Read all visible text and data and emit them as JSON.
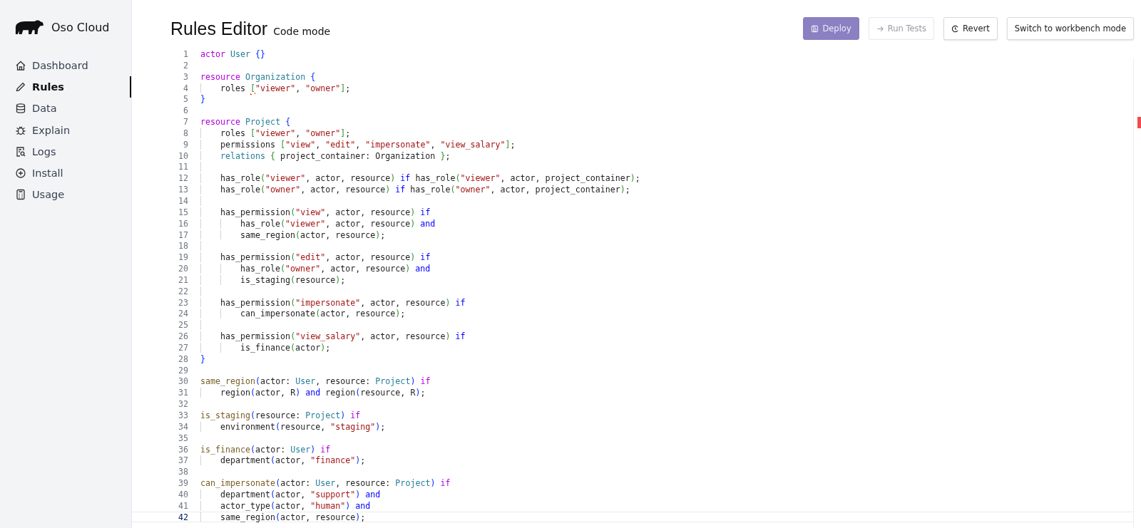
{
  "brand": {
    "name": "Oso Cloud"
  },
  "sidebar": {
    "items": [
      {
        "label": "Dashboard",
        "selected": false
      },
      {
        "label": "Rules",
        "selected": true
      },
      {
        "label": "Data",
        "selected": false
      },
      {
        "label": "Explain",
        "selected": false
      },
      {
        "label": "Logs",
        "selected": false
      },
      {
        "label": "Install",
        "selected": false
      },
      {
        "label": "Usage",
        "selected": false
      }
    ]
  },
  "header": {
    "title": "Rules Editor",
    "subtitle": "Code mode"
  },
  "buttons": [
    {
      "label": "Deploy",
      "kind": "primary",
      "disabled": true
    },
    {
      "label": "Run Tests",
      "kind": "outline",
      "disabled": true
    },
    {
      "label": "Revert",
      "kind": "outline",
      "disabled": false
    },
    {
      "label": "Switch to workbench mode",
      "kind": "outline",
      "disabled": false
    }
  ],
  "editor": {
    "lines": [
      {
        "number": "1",
        "active": false,
        "tokens": [
          {
            "kind": "kw",
            "text": "actor "
          },
          {
            "kind": "type",
            "text": "User "
          },
          {
            "kind": "b1",
            "text": "{}"
          }
        ]
      },
      {
        "number": "2",
        "active": false
      },
      {
        "number": "3",
        "active": false,
        "tokens": [
          {
            "kind": "kw",
            "text": "resource "
          },
          {
            "kind": "type",
            "text": "Organization "
          },
          {
            "kind": "b1",
            "text": "{"
          }
        ],
        "children": [
          {
            "number": "4",
            "active": false,
            "tokens": [
              {
                "kind": "p",
                "text": "roles "
              },
              {
                "kind": "bad",
                "text": "["
              },
              {
                "kind": "str",
                "text": "\"viewer\""
              },
              {
                "kind": "p",
                "text": ", "
              },
              {
                "kind": "str",
                "text": "\"owner\""
              },
              {
                "kind": "b2",
                "text": "]"
              },
              {
                "kind": "p",
                "text": ";"
              }
            ]
          }
        ]
      },
      {
        "number": "5",
        "active": false,
        "tokens": [
          {
            "kind": "b1",
            "text": "}"
          }
        ]
      },
      {
        "number": "6",
        "active": false
      },
      {
        "number": "7",
        "active": false,
        "tokens": [
          {
            "kind": "kw",
            "text": "resource "
          },
          {
            "kind": "type",
            "text": "Project "
          },
          {
            "kind": "b1",
            "text": "{"
          }
        ],
        "children": [
          {
            "number": "8",
            "active": false,
            "tokens": [
              {
                "kind": "p",
                "text": "roles "
              },
              {
                "kind": "b2",
                "text": "["
              },
              {
                "kind": "str",
                "text": "\"viewer\""
              },
              {
                "kind": "p",
                "text": ", "
              },
              {
                "kind": "str",
                "text": "\"owner\""
              },
              {
                "kind": "b2",
                "text": "]"
              },
              {
                "kind": "p",
                "text": ";"
              }
            ]
          },
          {
            "number": "9",
            "active": false,
            "tokens": [
              {
                "kind": "p",
                "text": "permissions "
              },
              {
                "kind": "b2",
                "text": "["
              },
              {
                "kind": "str",
                "text": "\"view\""
              },
              {
                "kind": "p",
                "text": ", "
              },
              {
                "kind": "str",
                "text": "\"edit\""
              },
              {
                "kind": "p",
                "text": ", "
              },
              {
                "kind": "str",
                "text": "\"impersonate\""
              },
              {
                "kind": "p",
                "text": ", "
              },
              {
                "kind": "str",
                "text": "\"view_salary\""
              },
              {
                "kind": "b2",
                "text": "]"
              },
              {
                "kind": "p",
                "text": ";"
              }
            ]
          },
          {
            "number": "10",
            "active": false,
            "tokens": [
              {
                "kind": "type",
                "text": "relations "
              },
              {
                "kind": "b2",
                "text": "{"
              },
              {
                "kind": "p",
                "text": " project_container: Organization "
              },
              {
                "kind": "b2",
                "text": "}"
              },
              {
                "kind": "p",
                "text": ";"
              }
            ]
          },
          {
            "number": "11",
            "active": false
          },
          {
            "number": "12",
            "active": false,
            "tokens": [
              {
                "kind": "p",
                "text": "has_role"
              },
              {
                "kind": "b2",
                "text": "("
              },
              {
                "kind": "str",
                "text": "\"viewer\""
              },
              {
                "kind": "p",
                "text": ", actor, resource"
              },
              {
                "kind": "b2",
                "text": ")"
              },
              {
                "kind": "logic",
                "text": " if "
              },
              {
                "kind": "p",
                "text": "has_role"
              },
              {
                "kind": "b2",
                "text": "("
              },
              {
                "kind": "str",
                "text": "\"viewer\""
              },
              {
                "kind": "p",
                "text": ", actor, project_container"
              },
              {
                "kind": "b2",
                "text": ")"
              },
              {
                "kind": "p",
                "text": ";"
              }
            ]
          },
          {
            "number": "13",
            "active": false,
            "tokens": [
              {
                "kind": "p",
                "text": "has_role"
              },
              {
                "kind": "b2",
                "text": "("
              },
              {
                "kind": "str",
                "text": "\"owner\""
              },
              {
                "kind": "p",
                "text": ", actor, resource"
              },
              {
                "kind": "b2",
                "text": ")"
              },
              {
                "kind": "logic",
                "text": " if "
              },
              {
                "kind": "p",
                "text": "has_role"
              },
              {
                "kind": "b2",
                "text": "("
              },
              {
                "kind": "str",
                "text": "\"owner\""
              },
              {
                "kind": "p",
                "text": ", actor, project_container"
              },
              {
                "kind": "b2",
                "text": ")"
              },
              {
                "kind": "p",
                "text": ";"
              }
            ]
          },
          {
            "number": "14",
            "active": false
          },
          {
            "number": "15",
            "active": false,
            "tokens": [
              {
                "kind": "p",
                "text": "has_permission"
              },
              {
                "kind": "b2",
                "text": "("
              },
              {
                "kind": "str",
                "text": "\"view\""
              },
              {
                "kind": "p",
                "text": ", actor, resource"
              },
              {
                "kind": "b2",
                "text": ")"
              },
              {
                "kind": "logic",
                "text": " if"
              }
            ],
            "children": [
              {
                "number": "16",
                "active": false,
                "tokens": [
                  {
                    "kind": "p",
                    "text": "has_role"
                  },
                  {
                    "kind": "b2",
                    "text": "("
                  },
                  {
                    "kind": "str",
                    "text": "\"viewer\""
                  },
                  {
                    "kind": "p",
                    "text": ", actor, resource"
                  },
                  {
                    "kind": "b2",
                    "text": ")"
                  },
                  {
                    "kind": "logic",
                    "text": " and"
                  }
                ]
              },
              {
                "number": "17",
                "active": false,
                "tokens": [
                  {
                    "kind": "p",
                    "text": "same_region"
                  },
                  {
                    "kind": "b2",
                    "text": "("
                  },
                  {
                    "kind": "p",
                    "text": "actor, resource"
                  },
                  {
                    "kind": "b2",
                    "text": ")"
                  },
                  {
                    "kind": "p",
                    "text": ";"
                  }
                ]
              }
            ]
          },
          {
            "number": "18",
            "active": false
          },
          {
            "number": "19",
            "active": false,
            "tokens": [
              {
                "kind": "p",
                "text": "has_permission"
              },
              {
                "kind": "b2",
                "text": "("
              },
              {
                "kind": "str",
                "text": "\"edit\""
              },
              {
                "kind": "p",
                "text": ", actor, resource"
              },
              {
                "kind": "b2",
                "text": ")"
              },
              {
                "kind": "logic",
                "text": " if"
              }
            ],
            "children": [
              {
                "number": "20",
                "active": false,
                "tokens": [
                  {
                    "kind": "p",
                    "text": "has_role"
                  },
                  {
                    "kind": "b2",
                    "text": "("
                  },
                  {
                    "kind": "str",
                    "text": "\"owner\""
                  },
                  {
                    "kind": "p",
                    "text": ", actor, resource"
                  },
                  {
                    "kind": "b2",
                    "text": ")"
                  },
                  {
                    "kind": "logic",
                    "text": " and"
                  }
                ]
              },
              {
                "number": "21",
                "active": false,
                "tokens": [
                  {
                    "kind": "p",
                    "text": "is_staging"
                  },
                  {
                    "kind": "b2",
                    "text": "("
                  },
                  {
                    "kind": "p",
                    "text": "resource"
                  },
                  {
                    "kind": "b2",
                    "text": ")"
                  },
                  {
                    "kind": "p",
                    "text": ";"
                  }
                ]
              }
            ]
          },
          {
            "number": "22",
            "active": false
          },
          {
            "number": "23",
            "active": false,
            "tokens": [
              {
                "kind": "p",
                "text": "has_permission"
              },
              {
                "kind": "b2",
                "text": "("
              },
              {
                "kind": "str",
                "text": "\"impersonate\""
              },
              {
                "kind": "p",
                "text": ", actor, resource"
              },
              {
                "kind": "b2",
                "text": ")"
              },
              {
                "kind": "logic",
                "text": " if"
              }
            ],
            "children": [
              {
                "number": "24",
                "active": false,
                "tokens": [
                  {
                    "kind": "p",
                    "text": "can_impersonate"
                  },
                  {
                    "kind": "b2",
                    "text": "("
                  },
                  {
                    "kind": "p",
                    "text": "actor, resource"
                  },
                  {
                    "kind": "b2",
                    "text": ")"
                  },
                  {
                    "kind": "p",
                    "text": ";"
                  }
                ]
              }
            ]
          },
          {
            "number": "25",
            "active": false
          },
          {
            "number": "26",
            "active": false,
            "tokens": [
              {
                "kind": "p",
                "text": "has_permission"
              },
              {
                "kind": "b2",
                "text": "("
              },
              {
                "kind": "str",
                "text": "\"view_salary\""
              },
              {
                "kind": "p",
                "text": ", actor, resource"
              },
              {
                "kind": "b2",
                "text": ")"
              },
              {
                "kind": "logic",
                "text": " if"
              }
            ],
            "children": [
              {
                "number": "27",
                "active": false,
                "tokens": [
                  {
                    "kind": "p",
                    "text": "is_finance"
                  },
                  {
                    "kind": "b2",
                    "text": "("
                  },
                  {
                    "kind": "p",
                    "text": "actor"
                  },
                  {
                    "kind": "b2",
                    "text": ")"
                  },
                  {
                    "kind": "p",
                    "text": ";"
                  }
                ]
              }
            ]
          }
        ]
      },
      {
        "number": "28",
        "active": false,
        "tokens": [
          {
            "kind": "b1",
            "text": "}"
          }
        ]
      },
      {
        "number": "29",
        "active": false
      },
      {
        "number": "30",
        "active": false,
        "tokens": [
          {
            "kind": "fn",
            "text": "same_region"
          },
          {
            "kind": "b1",
            "text": "("
          },
          {
            "kind": "p",
            "text": "actor: "
          },
          {
            "kind": "type",
            "text": "User"
          },
          {
            "kind": "p",
            "text": ", resource: "
          },
          {
            "kind": "type",
            "text": "Project"
          },
          {
            "kind": "b1",
            "text": ")"
          },
          {
            "kind": "kw",
            "text": " if"
          }
        ],
        "children": [
          {
            "number": "31",
            "active": false,
            "tokens": [
              {
                "kind": "p",
                "text": "region"
              },
              {
                "kind": "b1",
                "text": "("
              },
              {
                "kind": "p",
                "text": "actor, R"
              },
              {
                "kind": "b1",
                "text": ")"
              },
              {
                "kind": "logic",
                "text": " and "
              },
              {
                "kind": "p",
                "text": "region"
              },
              {
                "kind": "b1",
                "text": "("
              },
              {
                "kind": "p",
                "text": "resource, R"
              },
              {
                "kind": "b1",
                "text": ")"
              },
              {
                "kind": "p",
                "text": ";"
              }
            ]
          }
        ]
      },
      {
        "number": "32",
        "active": false
      },
      {
        "number": "33",
        "active": false,
        "tokens": [
          {
            "kind": "fn",
            "text": "is_staging"
          },
          {
            "kind": "b1",
            "text": "("
          },
          {
            "kind": "p",
            "text": "resource: "
          },
          {
            "kind": "type",
            "text": "Project"
          },
          {
            "kind": "b1",
            "text": ")"
          },
          {
            "kind": "kw",
            "text": " if"
          }
        ],
        "children": [
          {
            "number": "34",
            "active": false,
            "tokens": [
              {
                "kind": "p",
                "text": "environment"
              },
              {
                "kind": "b1",
                "text": "("
              },
              {
                "kind": "p",
                "text": "resource, "
              },
              {
                "kind": "str",
                "text": "\"staging\""
              },
              {
                "kind": "b1",
                "text": ")"
              },
              {
                "kind": "p",
                "text": ";"
              }
            ]
          }
        ]
      },
      {
        "number": "35",
        "active": false
      },
      {
        "number": "36",
        "active": false,
        "tokens": [
          {
            "kind": "fn",
            "text": "is_finance"
          },
          {
            "kind": "b1",
            "text": "("
          },
          {
            "kind": "p",
            "text": "actor: "
          },
          {
            "kind": "type",
            "text": "User"
          },
          {
            "kind": "b1",
            "text": ")"
          },
          {
            "kind": "kw",
            "text": " if"
          }
        ],
        "children": [
          {
            "number": "37",
            "active": false,
            "tokens": [
              {
                "kind": "p",
                "text": "department"
              },
              {
                "kind": "b1",
                "text": "("
              },
              {
                "kind": "p",
                "text": "actor, "
              },
              {
                "kind": "str",
                "text": "\"finance\""
              },
              {
                "kind": "b1",
                "text": ")"
              },
              {
                "kind": "p",
                "text": ";"
              }
            ]
          }
        ]
      },
      {
        "number": "38",
        "active": false
      },
      {
        "number": "39",
        "active": false,
        "tokens": [
          {
            "kind": "fn",
            "text": "can_impersonate"
          },
          {
            "kind": "b1",
            "text": "("
          },
          {
            "kind": "p",
            "text": "actor: "
          },
          {
            "kind": "type",
            "text": "User"
          },
          {
            "kind": "p",
            "text": ", resource: "
          },
          {
            "kind": "type",
            "text": "Project"
          },
          {
            "kind": "b1",
            "text": ")"
          },
          {
            "kind": "kw",
            "text": " if"
          }
        ],
        "children": [
          {
            "number": "40",
            "active": false,
            "tokens": [
              {
                "kind": "p",
                "text": "department"
              },
              {
                "kind": "b1",
                "text": "("
              },
              {
                "kind": "p",
                "text": "actor, "
              },
              {
                "kind": "str",
                "text": "\"support\""
              },
              {
                "kind": "b1",
                "text": ")"
              },
              {
                "kind": "logic",
                "text": " and"
              }
            ]
          },
          {
            "number": "41",
            "active": false,
            "tokens": [
              {
                "kind": "p",
                "text": "actor_type"
              },
              {
                "kind": "b1",
                "text": "("
              },
              {
                "kind": "p",
                "text": "actor, "
              },
              {
                "kind": "str",
                "text": "\"human\""
              },
              {
                "kind": "b1",
                "text": ")"
              },
              {
                "kind": "logic",
                "text": " and"
              }
            ]
          },
          {
            "number": "42",
            "active": true,
            "tokens": [
              {
                "kind": "p",
                "text": "same_region"
              },
              {
                "kind": "b1",
                "text": "("
              },
              {
                "kind": "p",
                "text": "actor, resource"
              },
              {
                "kind": "b1",
                "text": ")"
              },
              {
                "kind": "p",
                "text": ";"
              }
            ]
          }
        ]
      }
    ]
  }
}
